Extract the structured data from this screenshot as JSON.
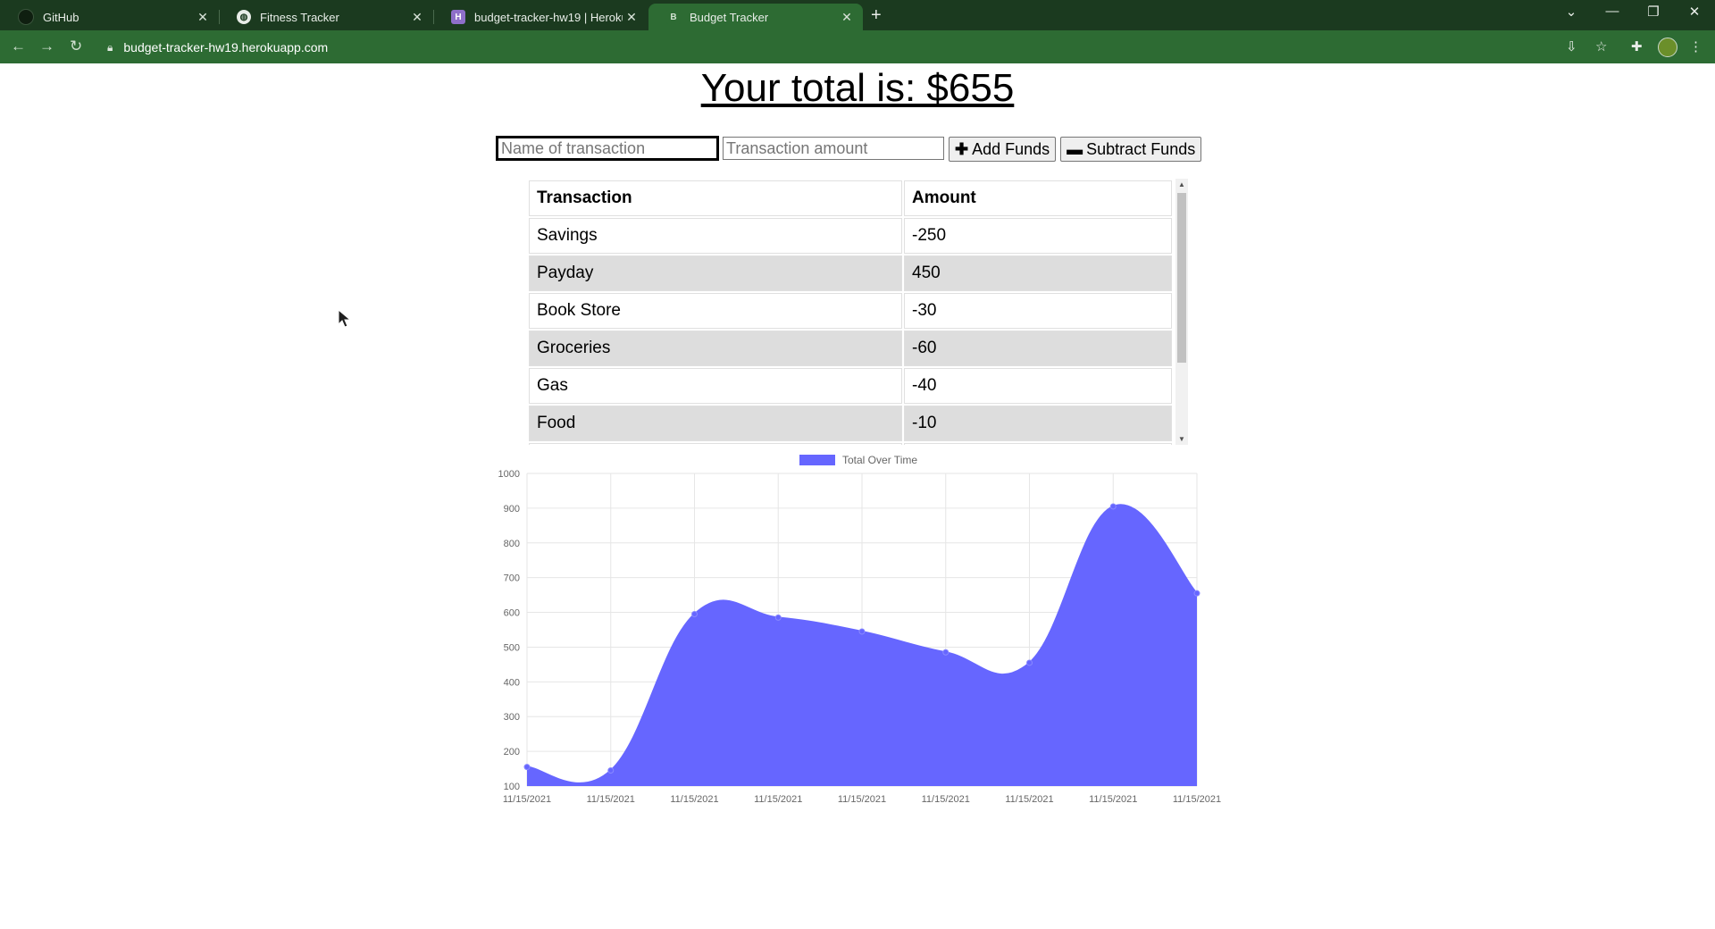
{
  "browser": {
    "tabs": [
      {
        "title": "GitHub",
        "icon": "github-icon"
      },
      {
        "title": "Fitness Tracker",
        "icon": "globe-icon"
      },
      {
        "title": "budget-tracker-hw19 | Heroku",
        "icon": "heroku-icon"
      },
      {
        "title": "Budget Tracker",
        "icon": "budget-tracker-icon"
      }
    ],
    "url": "budget-tracker-hw19.herokuapp.com"
  },
  "page": {
    "total_text": "Your total is: $655",
    "form": {
      "name_placeholder": "Name of transaction",
      "amount_placeholder": "Transaction amount",
      "add_label": "Add Funds",
      "subtract_label": "Subtract Funds"
    },
    "table": {
      "headers": [
        "Transaction",
        "Amount"
      ],
      "rows": [
        {
          "name": "Savings",
          "amount": "-250"
        },
        {
          "name": "Payday",
          "amount": "450"
        },
        {
          "name": "Book Store",
          "amount": "-30"
        },
        {
          "name": "Groceries",
          "amount": "-60"
        },
        {
          "name": "Gas",
          "amount": "-40"
        },
        {
          "name": "Food",
          "amount": "-10"
        }
      ]
    }
  },
  "chart_data": {
    "type": "area",
    "series": [
      {
        "name": "Total Over Time",
        "values": [
          155,
          145,
          595,
          585,
          545,
          485,
          455,
          905,
          655
        ]
      }
    ],
    "x": [
      "11/15/2021",
      "11/15/2021",
      "11/15/2021",
      "11/15/2021",
      "11/15/2021",
      "11/15/2021",
      "11/15/2021",
      "11/15/2021",
      "11/15/2021"
    ],
    "ylim": [
      100,
      1000
    ],
    "yticks": [
      100,
      200,
      300,
      400,
      500,
      600,
      700,
      800,
      900,
      1000
    ],
    "color": "#6666ff",
    "legend": "top-center",
    "grid": true
  }
}
